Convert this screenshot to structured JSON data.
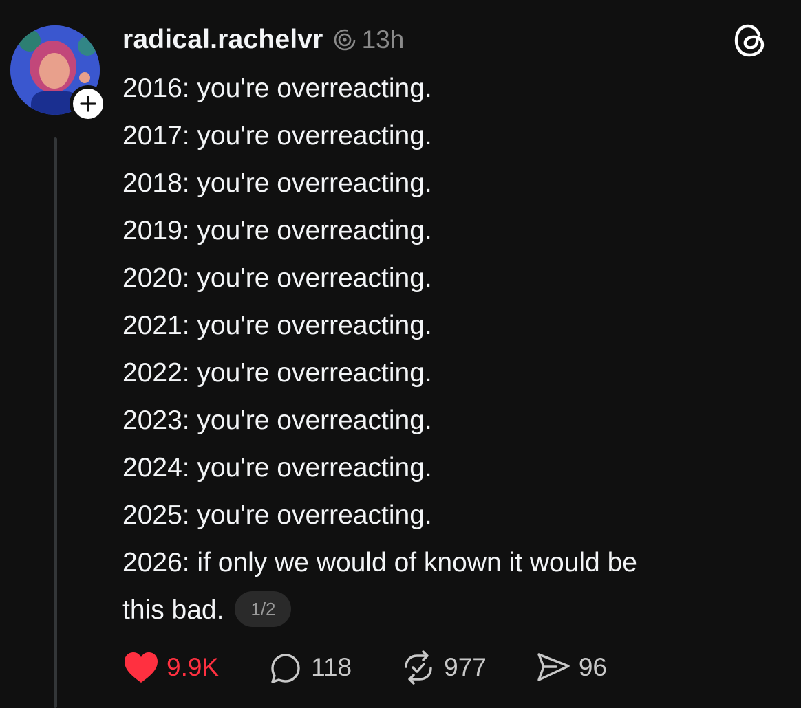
{
  "post": {
    "username": "radical.rachelvr",
    "time": "13h",
    "lines": [
      "2016: you're overreacting.",
      "2017: you're overreacting.",
      "2018: you're overreacting.",
      "2019: you're overreacting.",
      "2020: you're overreacting.",
      "2021: you're overreacting.",
      "2022: you're overreacting.",
      "2023: you're overreacting.",
      "2024: you're overreacting.",
      "2025: you're overreacting.",
      "2026: if only we would of known it would be",
      "this bad."
    ],
    "page_indicator": "1/2"
  },
  "actions": {
    "likes": "9.9K",
    "replies": "118",
    "reposts": "977",
    "shares": "96"
  },
  "colors": {
    "background": "#101010",
    "text": "#f3f5f7",
    "muted": "#8a8a8a",
    "like_red": "#ff3040"
  },
  "icons": {
    "activity": "activity-icon",
    "threads": "threads-logo-icon",
    "like": "heart-icon",
    "reply": "comment-icon",
    "repost": "repost-icon",
    "share": "send-icon",
    "follow": "plus-icon"
  }
}
